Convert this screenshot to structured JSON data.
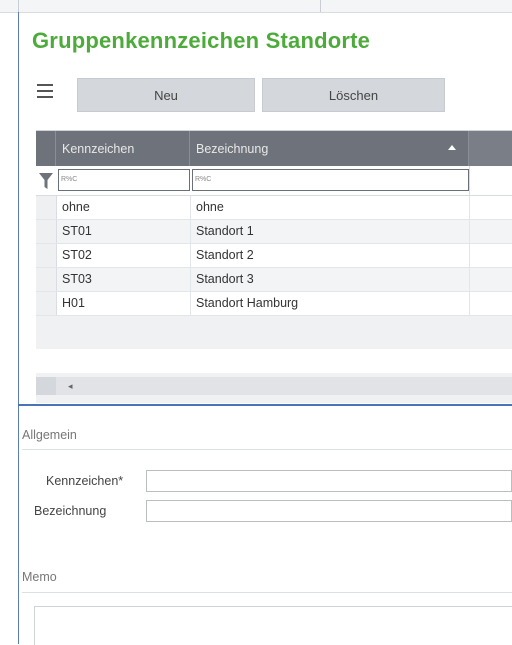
{
  "title": "Gruppenkennzeichen Standorte",
  "toolbar": {
    "new_label": "Neu",
    "delete_label": "Löschen",
    "menu_icon": "hamburger-icon"
  },
  "grid": {
    "columns": [
      "Kennzeichen",
      "Bezeichnung"
    ],
    "sort_column": "Bezeichnung",
    "sort_direction": "ascending",
    "filter_placeholders": [
      "R%C",
      "R%C"
    ],
    "rows": [
      [
        "ohne",
        "ohne"
      ],
      [
        "ST01",
        "Standort 1"
      ],
      [
        "ST02",
        "Standort 2"
      ],
      [
        "ST03",
        "Standort 3"
      ],
      [
        "H01",
        "Standort Hamburg"
      ]
    ],
    "scroll_arrow": "◂"
  },
  "sections": {
    "general": "Allgemein",
    "memo": "Memo"
  },
  "form": {
    "kennzeichen_label": "Kennzeichen*",
    "bezeichnung_label": "Bezeichnung",
    "kennzeichen_value": "",
    "bezeichnung_value": ""
  },
  "colors": {
    "title": "#4cab3a",
    "header": "#6e727a",
    "divider": "#4a74b5"
  }
}
